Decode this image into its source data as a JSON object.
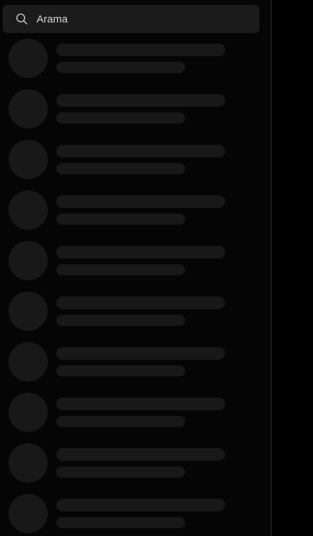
{
  "search": {
    "placeholder": "Arama",
    "icon": "search-icon"
  },
  "list": {
    "state": "loading",
    "skeleton_rows": 10
  },
  "colors": {
    "background": "#000000",
    "panel": "#050505",
    "search_bg": "#1b1b1b",
    "skeleton": "#181818",
    "divider": "#2e2e2e",
    "text": "#d8d8d8"
  }
}
